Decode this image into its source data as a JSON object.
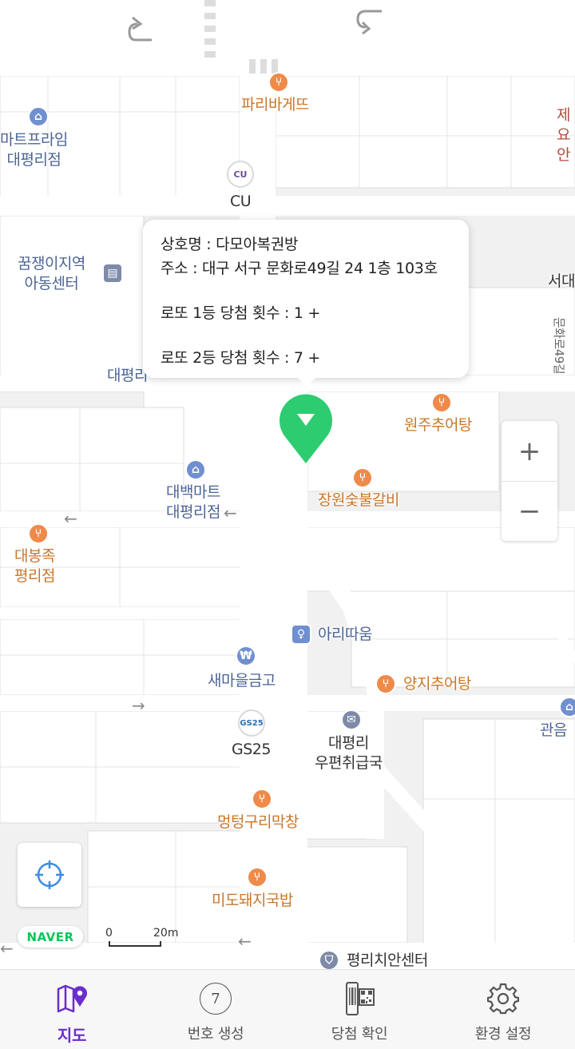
{
  "map": {
    "pois": [
      {
        "label": "파리바게뜨",
        "type": "food"
      },
      {
        "label": "마트프라임\n대평리점",
        "type": "blue"
      },
      {
        "label": "CU",
        "type": "dark"
      },
      {
        "label": "제\n요안",
        "type": "red"
      },
      {
        "label": "꿈쟁이지역\n아동센터",
        "type": "blue"
      },
      {
        "label": "서대",
        "type": "dark"
      },
      {
        "label": "문화로49길",
        "type": "dark"
      },
      {
        "label": "대평리",
        "type": "blue"
      },
      {
        "label": "원주추어탕",
        "type": "food"
      },
      {
        "label": "대백마트\n대평리점",
        "type": "blue"
      },
      {
        "label": "장원숯불갈비",
        "type": "food"
      },
      {
        "label": "대봉족\n평리점",
        "type": "food"
      },
      {
        "label": "아리따움",
        "type": "blue"
      },
      {
        "label": "새마을금고",
        "type": "blue"
      },
      {
        "label": "양지추어탕",
        "type": "food"
      },
      {
        "label": "GS25",
        "type": "dark"
      },
      {
        "label": "대평리\n우편취급국",
        "type": "dark"
      },
      {
        "label": "관음",
        "type": "blue"
      },
      {
        "label": "멍텅구리막창",
        "type": "food"
      },
      {
        "label": "미도돼지국밥",
        "type": "food"
      },
      {
        "label": "평리치안센터",
        "type": "dark"
      }
    ],
    "badges": {
      "cu": "CU",
      "gs": "GS25"
    },
    "info_window": {
      "shop_name": "상호명 : 다모아복권방",
      "address": "주소 : 대구 서구 문화로49길 24 1층 103호",
      "first_prize": "로또 1등 당첨 횟수 :  1 +",
      "second_prize": "로또 2등 당첨 횟수 :  7 +"
    },
    "zoom": {
      "in_label": "+",
      "out_label": "−"
    },
    "brand": "NAVER",
    "scale": {
      "start": "0",
      "end": "20m"
    },
    "marker_color": "#2ecc71"
  },
  "tabs": [
    {
      "label": "지도",
      "icon": "map-pin-icon",
      "active": true
    },
    {
      "label": "번호 생성",
      "icon": "number-ball-icon",
      "badge": "7"
    },
    {
      "label": "당첨 확인",
      "icon": "qr-scan-icon"
    },
    {
      "label": "환경 설정",
      "icon": "gear-icon"
    }
  ],
  "colors": {
    "accent": "#6a2ecb",
    "naver": "#03c75a"
  }
}
